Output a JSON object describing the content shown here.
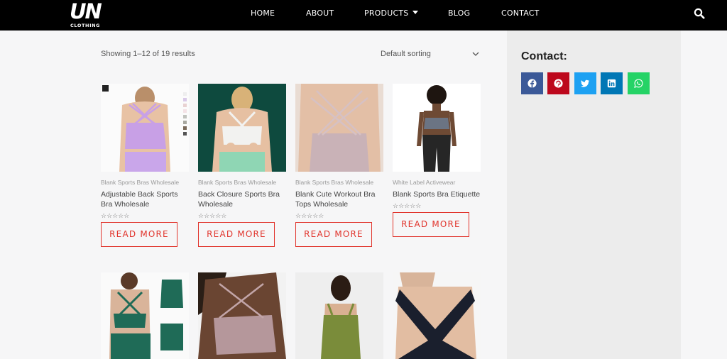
{
  "header": {
    "logo_main": "UN",
    "logo_sub": "CLOTHING",
    "nav": [
      "HOME",
      "ABOUT",
      "PRODUCTS",
      "BLOG",
      "CONTACT"
    ]
  },
  "shop": {
    "result_count": "Showing 1–12 of 19 results",
    "sorting": "Default sorting"
  },
  "products": [
    {
      "category": "Blank Sports Bras Wholesale",
      "title": "Adjustable Back Sports Bra Wholesale",
      "button": "READ MORE",
      "rating_stars": "☆☆☆☆☆"
    },
    {
      "category": "Blank Sports Bras Wholesale",
      "title": "Back Closure Sports Bra Wholesale",
      "button": "READ MORE",
      "rating_stars": "☆☆☆☆☆"
    },
    {
      "category": "Blank Sports Bras Wholesale",
      "title": "Blank Cute Workout Bra Tops Wholesale",
      "button": "READ MORE",
      "rating_stars": "☆☆☆☆☆"
    },
    {
      "category": "White Label Activewear",
      "title": "Blank Sports Bra Etiquette",
      "button": "READ MORE",
      "rating_stars": "☆☆☆☆☆"
    }
  ],
  "sidebar": {
    "contact_title": "Contact:",
    "share_buttons": [
      {
        "icon": "facebook-icon",
        "color": "#3b5998"
      },
      {
        "icon": "pinterest-icon",
        "color": "#bd081c"
      },
      {
        "icon": "twitter-icon",
        "color": "#1da1f2"
      },
      {
        "icon": "linkedin-icon",
        "color": "#0077b5"
      },
      {
        "icon": "whatsapp-icon",
        "color": "#25d366"
      }
    ]
  },
  "colors": {
    "accent": "#e1342c",
    "header_bg": "#000000",
    "sidebar_bg": "#ececec"
  }
}
